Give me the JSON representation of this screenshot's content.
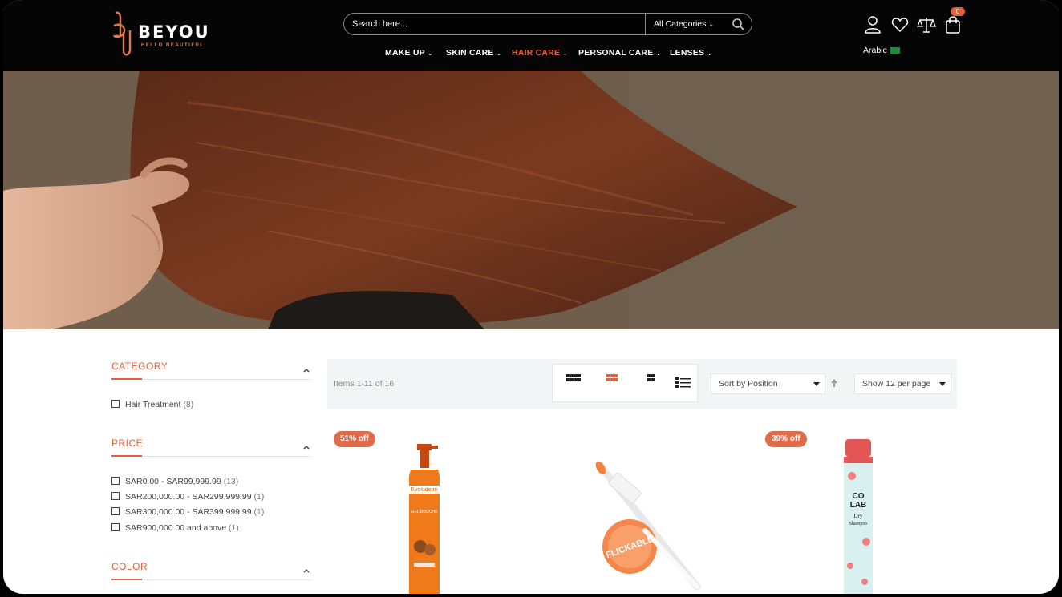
{
  "brand": {
    "name": "BEYOU",
    "tagline": "HELLO BEAUTIFUL"
  },
  "search": {
    "placeholder": "Search here...",
    "category": "All Categories"
  },
  "header": {
    "cart_count": "0",
    "language": "Arabic"
  },
  "nav": [
    {
      "label": "MAKE UP",
      "active": false
    },
    {
      "label": "SKIN CARE",
      "active": false
    },
    {
      "label": "HAIR CARE",
      "active": true
    },
    {
      "label": "PERSONAL CARE",
      "active": false
    },
    {
      "label": "LENSES",
      "active": false
    }
  ],
  "sidebar": {
    "category": {
      "title": "CATEGORY",
      "items": [
        {
          "label": "Hair Treatment",
          "count": "(8)"
        }
      ]
    },
    "price": {
      "title": "PRICE",
      "items": [
        {
          "label": "SAR0.00 - SAR99,999.99",
          "count": "(13)"
        },
        {
          "label": "SAR200,000.00 - SAR299,999.99",
          "count": "(1)"
        },
        {
          "label": "SAR300,000.00 - SAR399,999.99",
          "count": "(1)"
        },
        {
          "label": "SAR900,000.00 and above",
          "count": "(1)"
        }
      ]
    },
    "color": {
      "title": "COLOR"
    }
  },
  "toolbar": {
    "items_count": "Items 1-11 of 16",
    "sort_label": "Sort by Position",
    "limiter_label": "Show 12 per page"
  },
  "products": [
    {
      "badge": "51% off",
      "image": "orange-shower-gel-bottle",
      "product_text": [
        "Evoluderm",
        "GEL DOUCHE"
      ]
    },
    {
      "badge": "",
      "image": "orange-lip-gloss-ball",
      "product_text": [
        "FLICKABLE"
      ]
    },
    {
      "badge": "39% off",
      "image": "dry-shampoo-can",
      "product_text": [
        "CO",
        "LAB",
        "Dry",
        "Shampoo"
      ]
    }
  ],
  "colors": {
    "accent": "#e5603a",
    "header_bg": "#050505",
    "badge": "#e06b4a"
  }
}
